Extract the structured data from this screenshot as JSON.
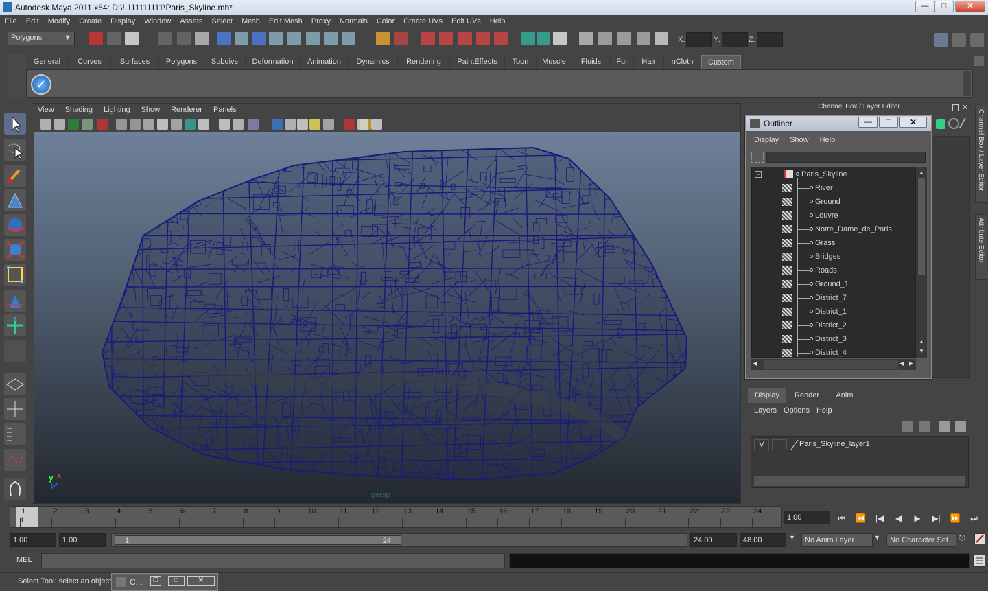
{
  "window": {
    "title": "Autodesk Maya 2011 x64: D:\\! 111111111\\Paris_Skyline.mb*",
    "min_label": "—",
    "max_label": "□",
    "close_label": "✕"
  },
  "menubar": [
    "File",
    "Edit",
    "Modify",
    "Create",
    "Display",
    "Window",
    "Assets",
    "Select",
    "Mesh",
    "Edit Mesh",
    "Proxy",
    "Normals",
    "Color",
    "Create UVs",
    "Edit UVs",
    "Help"
  ],
  "toolbar": {
    "mode": "Polygons",
    "x_label": "X:",
    "y_label": "Y:",
    "z_label": "Z:"
  },
  "shelf_tabs": [
    "General",
    "Curves",
    "Surfaces",
    "Polygons",
    "Subdivs",
    "Deformation",
    "Animation",
    "Dynamics",
    "Rendering",
    "PaintEffects",
    "Toon",
    "Muscle",
    "Fluids",
    "Fur",
    "Hair",
    "nCloth",
    "Custom"
  ],
  "shelf_active": "Custom",
  "viewport": {
    "menu": [
      "View",
      "Shading",
      "Lighting",
      "Show",
      "Renderer",
      "Panels"
    ],
    "camera_label": "persp",
    "axis_y": "y",
    "axis_x": "x",
    "wire_color": "#1a1a7a"
  },
  "channel_box": {
    "title": "Channel Box / Layer Editor"
  },
  "side_tabs": [
    "Channel Box / Layer Editor",
    "Attribute Editor"
  ],
  "outliner": {
    "title": "Outliner",
    "menu": [
      "Display",
      "Show",
      "Help"
    ],
    "root": "Paris_Skyline",
    "collapse_label": "−",
    "items": [
      "River",
      "Ground",
      "Louvre",
      "Notre_Dame_de_Paris",
      "Grass",
      "Bridges",
      "Roads",
      "Ground_1",
      "District_7",
      "District_1",
      "District_2",
      "District_3",
      "District_4"
    ]
  },
  "layer_editor": {
    "tabs": [
      "Display",
      "Render",
      "Anim"
    ],
    "menu": [
      "Layers",
      "Options",
      "Help"
    ],
    "layer_visible": "V",
    "layer_name": "Paris_Skyline_layer1"
  },
  "timeline": {
    "frames": [
      "1",
      "2",
      "3",
      "4",
      "5",
      "6",
      "7",
      "8",
      "9",
      "10",
      "11",
      "12",
      "13",
      "14",
      "15",
      "16",
      "17",
      "18",
      "19",
      "20",
      "21",
      "22",
      "23",
      "24"
    ],
    "current_frame": "1",
    "current_time": "1.00"
  },
  "playback": [
    "⏮",
    "⏪",
    "|◀",
    "◀",
    "▶",
    "▶|",
    "⏩",
    "⏭"
  ],
  "range": {
    "start": "1.00",
    "playback_start": "1.00",
    "slider_start": "1",
    "slider_end": "24",
    "playback_end": "24.00",
    "end": "48.00",
    "anim_layer": "No Anim Layer",
    "character_set": "No Character Set"
  },
  "command": {
    "label": "MEL"
  },
  "help_line": {
    "text": "Select Tool: select an object"
  },
  "minimized_window": {
    "title": "C..."
  }
}
